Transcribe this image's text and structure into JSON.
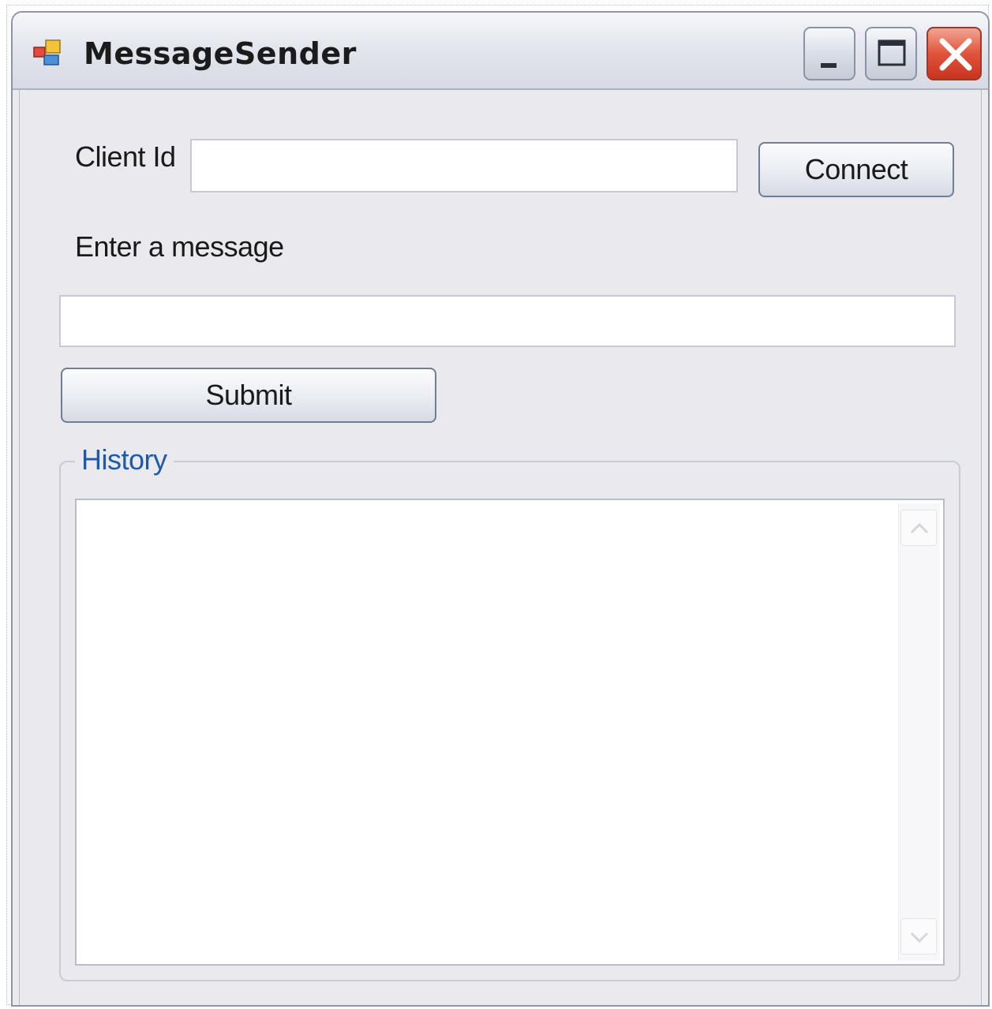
{
  "window": {
    "title": "MessageSender",
    "icon": "app-form-icon",
    "caption_buttons": [
      "minimize-icon",
      "maximize-icon",
      "close-icon"
    ]
  },
  "form": {
    "client_id_label": "Client Id",
    "client_id_value": "",
    "connect_label": "Connect",
    "message_label": "Enter a message",
    "message_value": "",
    "submit_label": "Submit"
  },
  "history": {
    "title": "History",
    "items": [],
    "scroll_icons": [
      "chevron-up-icon",
      "chevron-down-icon"
    ]
  },
  "colors": {
    "group_title": "#1f5aa8",
    "close_button": "#e0533c",
    "window_background": "#e9e9ee"
  }
}
